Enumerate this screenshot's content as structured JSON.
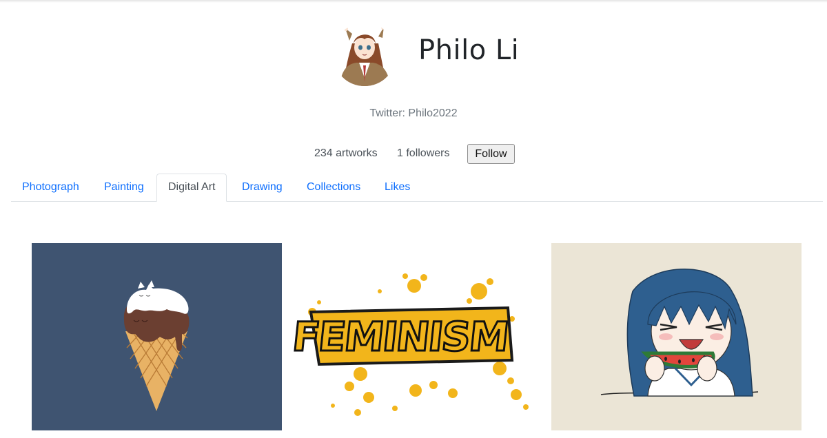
{
  "profile": {
    "name": "Philo Li",
    "twitter": "Twitter: Philo2022",
    "artworks": "234 artworks",
    "followers": "1 followers",
    "follow_label": "Follow"
  },
  "tabs": [
    {
      "label": "Photograph",
      "active": false
    },
    {
      "label": "Painting",
      "active": false
    },
    {
      "label": "Digital Art",
      "active": true
    },
    {
      "label": "Drawing",
      "active": false
    },
    {
      "label": "Collections",
      "active": false
    },
    {
      "label": "Likes",
      "active": false
    }
  ],
  "gallery": {
    "artworks": [
      {
        "subject": "ice cream cone with cat",
        "bg": "#3f5471"
      },
      {
        "subject": "feminism lettering",
        "text": "FEMINISM",
        "bg": "#ffffff"
      },
      {
        "subject": "anime girl eating watermelon",
        "bg": "#ebe5d6"
      }
    ]
  },
  "colors": {
    "link": "#0d6efd",
    "muted": "#6c757d",
    "accent_yellow": "#f2b51b"
  }
}
